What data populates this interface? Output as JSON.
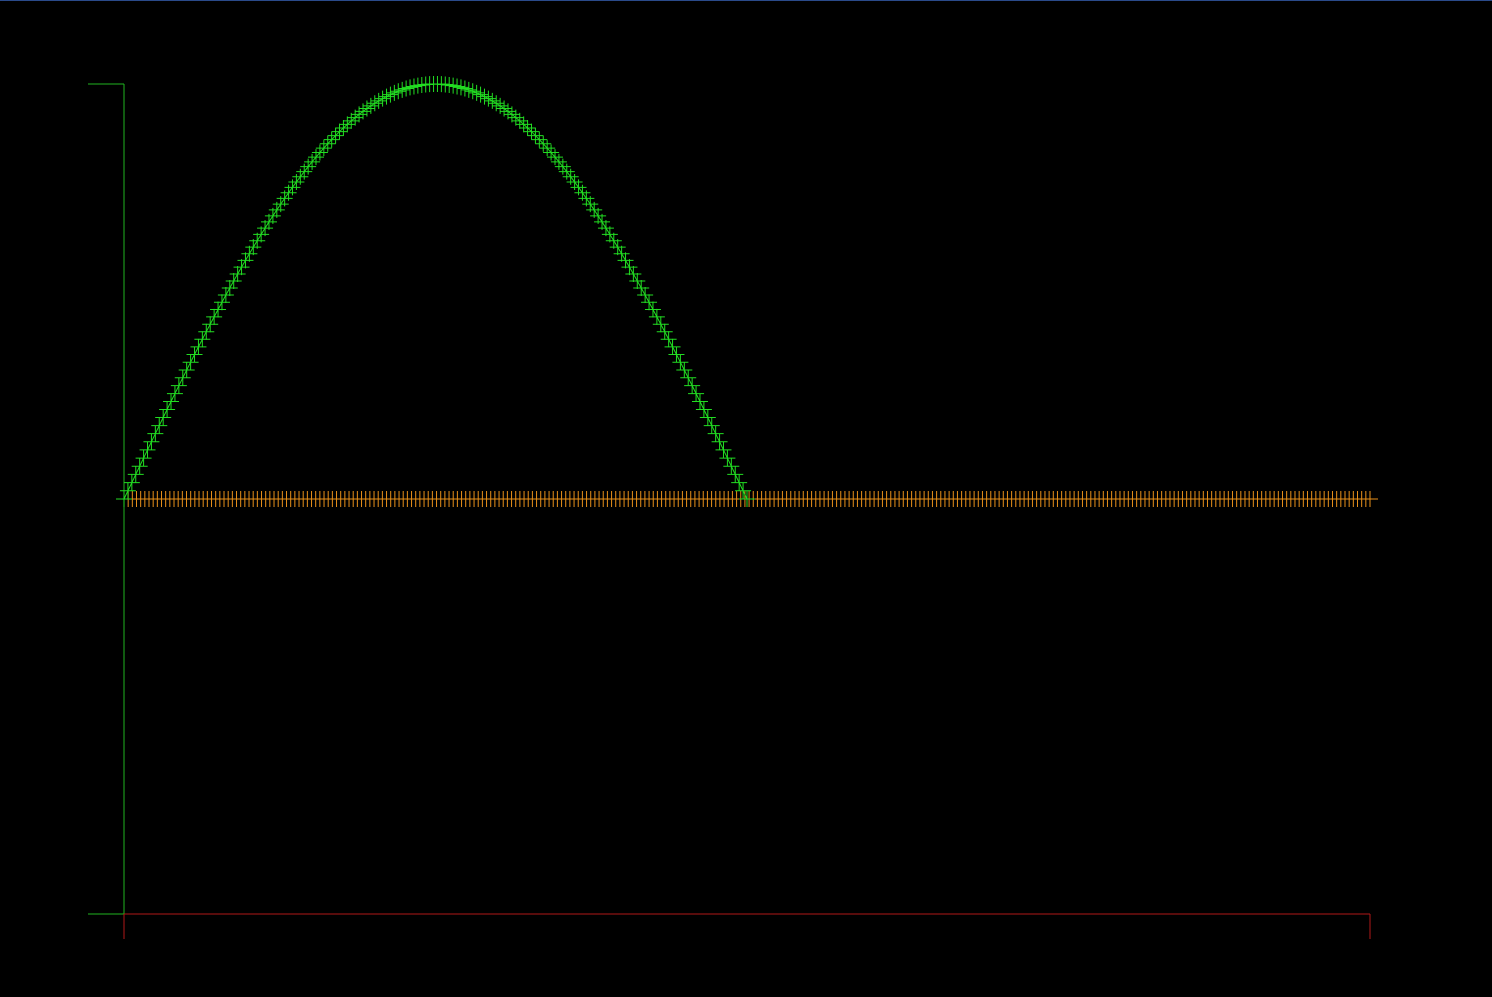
{
  "colors": {
    "background": "#000000",
    "window_border": "#2a4a8a",
    "y_axis": "#1fb51f",
    "x_axis": "#b01818",
    "sine_series": "#22dd22",
    "flat_series": "#e8901a"
  },
  "chart_data": {
    "type": "line",
    "title": "",
    "xlabel": "",
    "ylabel": "",
    "grid": false,
    "legend": false,
    "xlim": [
      0,
      1
    ],
    "ylim": [
      -1,
      1
    ],
    "marker": "plus",
    "series": [
      {
        "function": "sin(2*pi*x)",
        "x_range": [
          0,
          0.5
        ],
        "point_count": 160,
        "color": "#22dd22"
      },
      {
        "function": "0",
        "x_range": [
          0,
          1
        ],
        "point_count": 300,
        "color": "#e8901a"
      }
    ]
  }
}
